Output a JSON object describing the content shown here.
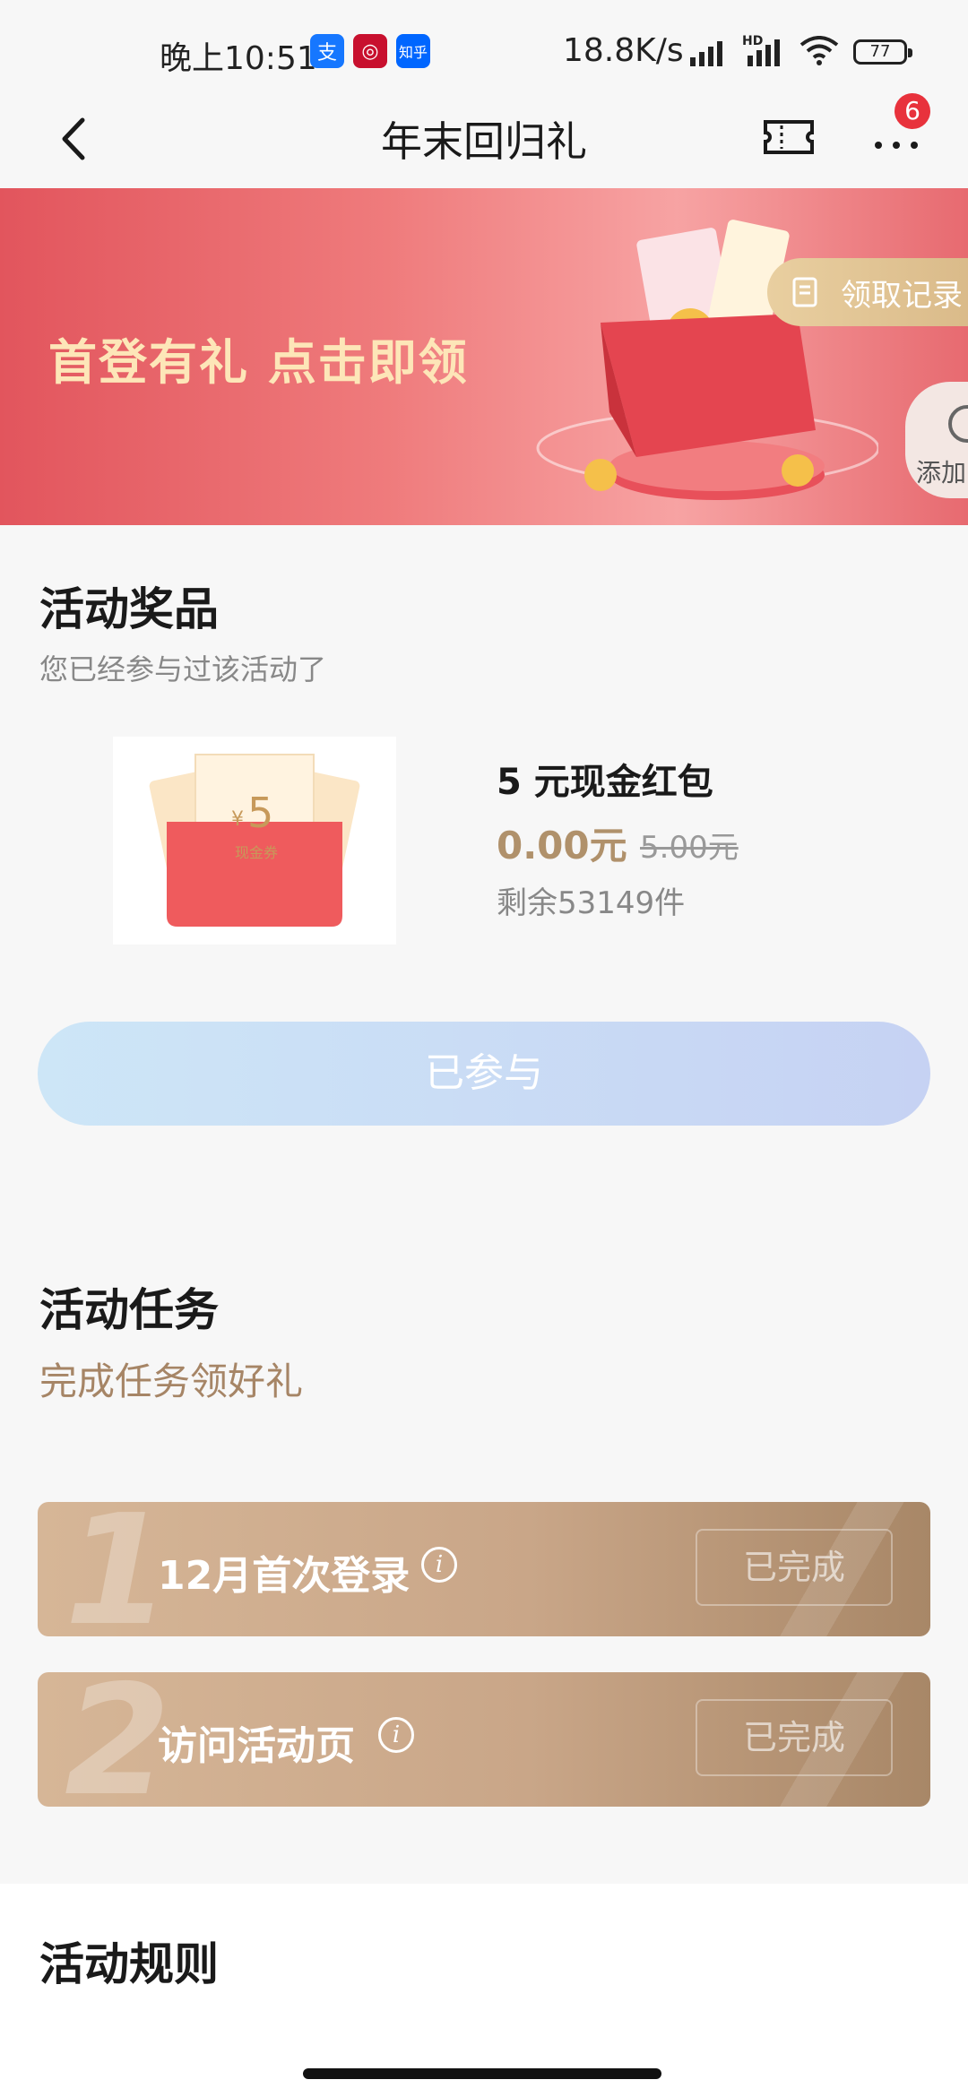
{
  "status_bar": {
    "time": "晚上10:51",
    "apps": [
      {
        "icon": "alipay-icon",
        "glyph": "支",
        "color": "#1677ff"
      },
      {
        "icon": "bank-icon",
        "glyph": "◎",
        "color": "#c8102e"
      },
      {
        "icon": "zhihu-icon",
        "glyph": "知乎",
        "color": "#0066ff"
      }
    ],
    "speed": "18.8K/s",
    "hd": "HD",
    "battery": "77"
  },
  "nav": {
    "title": "年末回归礼",
    "badge": "6"
  },
  "banner": {
    "headline": "首登有礼 点击即领",
    "record_label": "领取记录",
    "add_label": "添加"
  },
  "prize": {
    "section_title": "活动奖品",
    "section_sub": "您已经参与过该活动了",
    "image_amount": "5",
    "image_currency": "¥",
    "image_caption": "现金券",
    "name": "5 元现金红包",
    "price": "0.00元",
    "original_price": "5.00元",
    "remaining": "剩余53149件",
    "button_label": "已参与"
  },
  "tasks": {
    "section_title": "活动任务",
    "section_sub": "完成任务领好礼",
    "items": [
      {
        "number": "1",
        "label": "12月首次登录",
        "status": "已完成"
      },
      {
        "number": "2",
        "label": "访问活动页",
        "status": "已完成"
      }
    ]
  },
  "rules": {
    "title": "活动规则"
  }
}
